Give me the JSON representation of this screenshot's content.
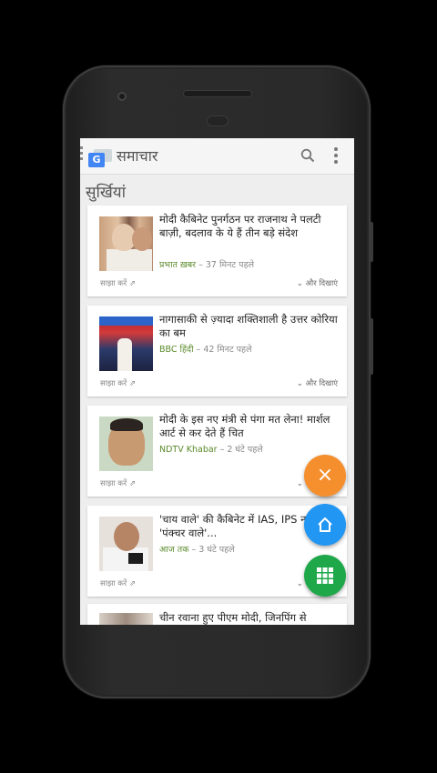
{
  "app": {
    "logo_letter": "G",
    "title": "समाचार"
  },
  "section_title": "सुर्खियां",
  "cards": [
    {
      "headline": "मोदी कैबिनेट पुनर्गठन पर राजनाथ ने पलटी बाज़ी, बदलाव के ये हैं तीन बड़े संदेश",
      "source": "प्रभात ख़बर",
      "time": " – 37 मिनट पहले",
      "share": "साझा करें ⇗",
      "more": "⌄ और दिखाएं"
    },
    {
      "headline": "नागासाकी से ज़्यादा शक्तिशाली है उत्तर कोरिया का बम",
      "source": "BBC हिंदी",
      "time": " – 42 मिनट पहले",
      "share": "साझा करें ⇗",
      "more": "⌄ और दिखाएं"
    },
    {
      "headline": "मोदी के इस नए मंत्री से पंगा मत लेना! मार्शल आर्ट से कर देते हैं चित",
      "source": "NDTV Khabar",
      "time": " – 2 घंटे पहले",
      "share": "साझा करें ⇗",
      "more": "⌄ और दिखाएं"
    },
    {
      "headline": "'चाय वाले' की कैबिनेट में IAS, IPS नहीं इस 'पंक्चर वाले'...",
      "source": "आज तक",
      "time": " – 3 घंटे पहले",
      "share": "साझा करें ⇗",
      "more": "⌄ और दिखाएं"
    },
    {
      "headline": "चीन रवाना हुए पीएम मोदी, जिनपिंग से",
      "source": "",
      "time": "",
      "share": "",
      "more": ""
    }
  ],
  "fab": {
    "close_symbol": "×"
  },
  "colors": {
    "source_green": "#5a8a2b",
    "fab_orange": "#f58f2d",
    "fab_blue": "#2196f3",
    "fab_green": "#1ea84a",
    "logo_blue": "#4285f4"
  }
}
